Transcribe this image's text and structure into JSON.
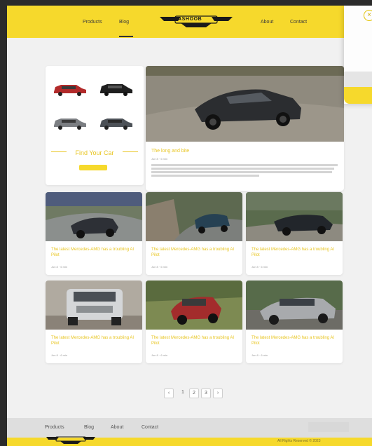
{
  "header": {
    "nav": [
      {
        "label": "Products"
      },
      {
        "label": "Blog"
      },
      {
        "label": "About"
      },
      {
        "label": "Contact"
      }
    ],
    "logo_text": "ASHOOB"
  },
  "find_car": {
    "title": "Find Your Car"
  },
  "featured": {
    "title": "The long and bite",
    "meta": "Jun 8 · 6 min"
  },
  "posts": [
    {
      "title": "The latest Mercedes-AMG has a troubling AI Pilot",
      "meta": "Jun 8 · 6 min"
    },
    {
      "title": "The latest Mercedes-AMG has a troubling AI Pilot",
      "meta": "Jun 8 · 6 min"
    },
    {
      "title": "The latest Mercedes-AMG has a troubling AI Pilot",
      "meta": "Jun 8 · 6 min"
    },
    {
      "title": "The latest Mercedes-AMG has a troubling AI Pilot",
      "meta": "Jun 8 · 6 min"
    },
    {
      "title": "The latest Mercedes-AMG has a troubling AI Pilot",
      "meta": "Jun 8 · 6 min"
    },
    {
      "title": "The latest Mercedes-AMG has a troubling AI Pilot",
      "meta": "Jun 8 · 6 min"
    }
  ],
  "pagination": {
    "prev": "‹",
    "pages": [
      "1",
      "2",
      "3"
    ],
    "next": "›"
  },
  "footer": {
    "nav": [
      {
        "label": "Products"
      },
      {
        "label": "Blog"
      },
      {
        "label": "About"
      },
      {
        "label": "Contact"
      }
    ],
    "copyright": "All Rights Reserved © 2023"
  },
  "drawer": {
    "close": "×"
  },
  "colors": {
    "accent": "#f6d92c",
    "accent_text": "#e8c520"
  }
}
